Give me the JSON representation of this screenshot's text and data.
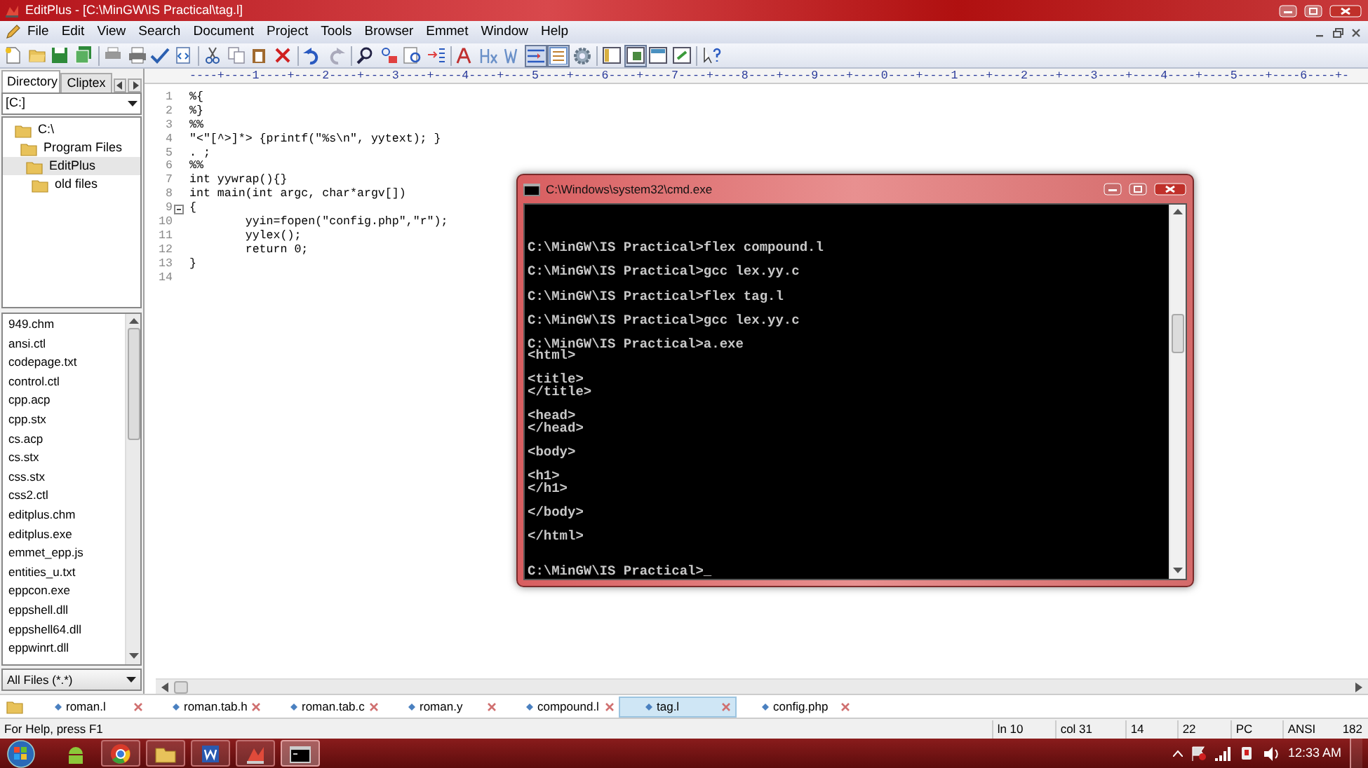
{
  "window": {
    "title": "EditPlus - [C:\\MinGW\\IS Practical\\tag.l]"
  },
  "menu": [
    "File",
    "Edit",
    "View",
    "Search",
    "Document",
    "Project",
    "Tools",
    "Browser",
    "Emmet",
    "Window",
    "Help"
  ],
  "toolbar": [
    {
      "pressed": false
    },
    {
      "pressed": false
    },
    {
      "pressed": false
    },
    {
      "pressed": false
    },
    {
      "pressed": false
    },
    {
      "pressed": false
    },
    {
      "pressed": false
    },
    {
      "pressed": false
    },
    {
      "pressed": false
    },
    {
      "pressed": false
    },
    {
      "pressed": false
    },
    {
      "pressed": false
    },
    {
      "pressed": false
    },
    {
      "pressed": false
    },
    {
      "pressed": false
    },
    {
      "pressed": false
    },
    {
      "pressed": false
    },
    {
      "pressed": false
    },
    {
      "pressed": false
    },
    {
      "pressed": false
    },
    {
      "pressed": false
    },
    {
      "pressed": true
    },
    {
      "pressed": true
    },
    {
      "pressed": false
    },
    {
      "pressed": false
    },
    {
      "pressed": true
    },
    {
      "pressed": false
    },
    {
      "pressed": false
    },
    {
      "pressed": false
    }
  ],
  "side_tabs": [
    {
      "label": "Directory",
      "selected": true
    },
    {
      "label": "Cliptex",
      "selected": false
    }
  ],
  "drive": "[C:]",
  "tree": [
    {
      "label": "C:\\",
      "selected": false,
      "children": [
        {
          "label": "Program Files",
          "selected": false,
          "children": [
            {
              "label": "EditPlus",
              "selected": true,
              "children": [
                {
                  "label": "old files",
                  "selected": false
                }
              ]
            }
          ]
        }
      ]
    }
  ],
  "files": [
    "949.chm",
    "ansi.ctl",
    "codepage.txt",
    "control.ctl",
    "cpp.acp",
    "cpp.stx",
    "cs.acp",
    "cs.stx",
    "css.stx",
    "css2.ctl",
    "editplus.chm",
    "editplus.exe",
    "emmet_epp.js",
    "entities_u.txt",
    "eppcon.exe",
    "eppshell.dll",
    "eppshell64.dll",
    "eppwinrt.dll"
  ],
  "filter": "All Files (*.*)",
  "editor": {
    "ruler": "----+----1----+----2----+----3----+----4----+----5----+----6----+----7----+----8----+----9----+----0----+----1----+----2----+----3----+----4----+----5----+----6----+-",
    "lines": [
      {
        "number": "1",
        "text": "%{",
        "fold": false
      },
      {
        "number": "2",
        "text": "%}",
        "fold": false
      },
      {
        "number": "3",
        "text": "%%",
        "fold": false
      },
      {
        "number": "4",
        "text": "\"<\"[^>]*> {printf(\"%s\\n\", yytext); }",
        "fold": false
      },
      {
        "number": "5",
        "text": ". ;",
        "fold": false
      },
      {
        "number": "6",
        "text": "%%",
        "fold": false
      },
      {
        "number": "7",
        "text": "int yywrap(){}",
        "fold": false
      },
      {
        "number": "8",
        "text": "int main(int argc, char*argv[])",
        "fold": false
      },
      {
        "number": "9",
        "text": "{",
        "fold": true
      },
      {
        "number": "10",
        "text": "\tyyin=fopen(\"config.php\",\"r\");",
        "fold": false
      },
      {
        "number": "11",
        "text": "\tyylex();",
        "fold": false
      },
      {
        "number": "12",
        "text": "\treturn 0;",
        "fold": false
      },
      {
        "number": "13",
        "text": "}",
        "fold": false
      },
      {
        "number": "14",
        "fold": false
      }
    ]
  },
  "console": {
    "title": "C:\\Windows\\system32\\cmd.exe",
    "output": "C:\\MinGW\\IS Practical>flex compound.l\n\nC:\\MinGW\\IS Practical>gcc lex.yy.c\n\nC:\\MinGW\\IS Practical>flex tag.l\n\nC:\\MinGW\\IS Practical>gcc lex.yy.c\n\nC:\\MinGW\\IS Practical>a.exe\n<html>\n\n<title>\n</title>\n\n<head>\n</head>\n\n<body>\n\n<h1>\n</h1>\n\n</body>\n\n</html>\n\n\nC:\\MinGW\\IS Practical>_"
  },
  "doc_tabs": [
    {
      "label": "roman.l",
      "selected": false
    },
    {
      "label": "roman.tab.h",
      "selected": false
    },
    {
      "label": "roman.tab.c",
      "selected": false
    },
    {
      "label": "roman.y",
      "selected": false
    },
    {
      "label": "compound.l",
      "selected": false
    },
    {
      "label": "tag.l",
      "selected": true
    },
    {
      "label": "config.php",
      "selected": false
    }
  ],
  "status": [
    "For Help, press F1",
    "ln 10",
    "col 31",
    "14",
    "22",
    "PC",
    "ANSI",
    "182"
  ],
  "taskbar": {
    "apps": [
      {
        "running": false,
        "active": false
      },
      {
        "running": true,
        "active": false
      },
      {
        "running": true,
        "active": false
      },
      {
        "running": true,
        "active": false
      },
      {
        "running": true,
        "active": false
      },
      {
        "running": true,
        "active": true
      }
    ],
    "clock": "12:33 AM"
  }
}
